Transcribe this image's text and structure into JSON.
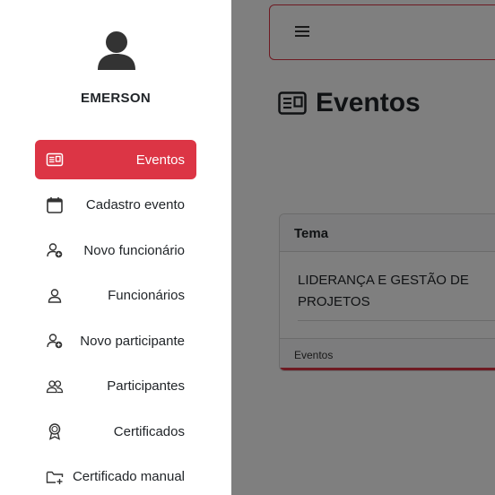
{
  "user": {
    "name": "EMERSON"
  },
  "nav": [
    {
      "label": "Eventos",
      "icon": "event-card-icon",
      "active": true
    },
    {
      "label": "Cadastro evento",
      "icon": "calendar-icon",
      "active": false
    },
    {
      "label": "Novo funcionário",
      "icon": "person-add-icon",
      "active": false
    },
    {
      "label": "Funcionários",
      "icon": "person-icon",
      "active": false
    },
    {
      "label": "Novo participante",
      "icon": "person-add-icon",
      "active": false
    },
    {
      "label": "Participantes",
      "icon": "people-icon",
      "active": false
    },
    {
      "label": "Certificados",
      "icon": "award-icon",
      "active": false
    },
    {
      "label": "Certificado manual",
      "icon": "folder-add-icon",
      "active": false
    }
  ],
  "main": {
    "title": "Eventos",
    "table": {
      "header": "Tema",
      "rows": [
        "LIDERANÇA E GESTÃO DE PROJETOS"
      ],
      "footer": "Eventos"
    }
  },
  "colors": {
    "accent": "#dc3545",
    "overlay": "rgba(0,0,0,0.5)"
  }
}
